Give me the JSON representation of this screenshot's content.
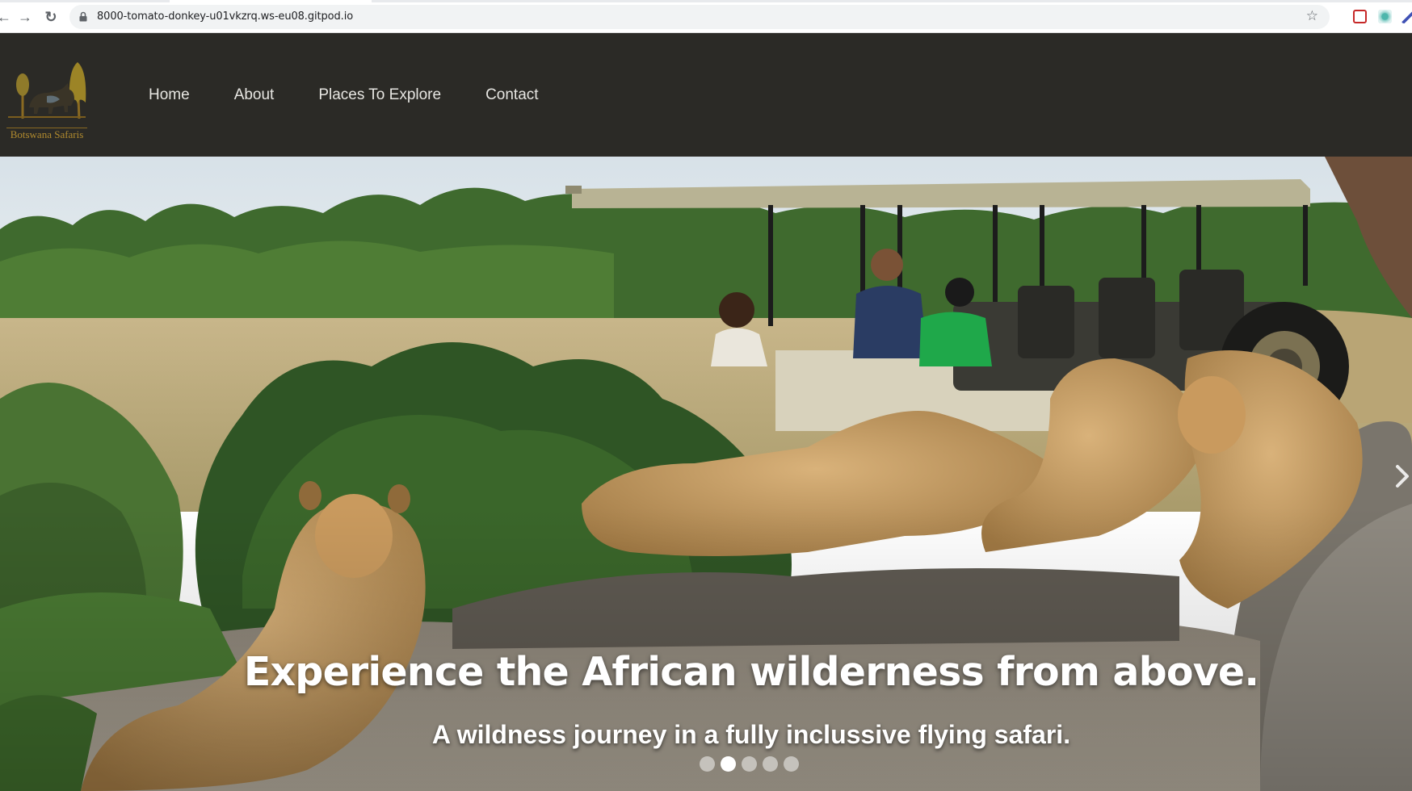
{
  "browser": {
    "url": "8000-tomato-donkey-u01vkzrq.ws-eu08.gitpod.io",
    "back_glyph": "←",
    "forward_glyph": "→",
    "reload_glyph": "↻",
    "star_glyph": "☆"
  },
  "header": {
    "logo_text": "Botswana Safaris",
    "nav": [
      {
        "label": "Home"
      },
      {
        "label": "About"
      },
      {
        "label": "Places To Explore"
      },
      {
        "label": "Contact"
      }
    ]
  },
  "hero": {
    "title": "Experience the African wilderness from above.",
    "subtitle": "A wildness journey in a fully inclussive flying safari.",
    "slide_count": 5,
    "active_slide": 2
  },
  "colors": {
    "header_bg": "#2b2a26",
    "nav_text": "#e7e6e2",
    "logo_gold": "#b08a2e"
  },
  "icons": [
    "back-icon",
    "forward-icon",
    "reload-icon",
    "lock-icon",
    "star-icon",
    "next-arrow-icon"
  ]
}
